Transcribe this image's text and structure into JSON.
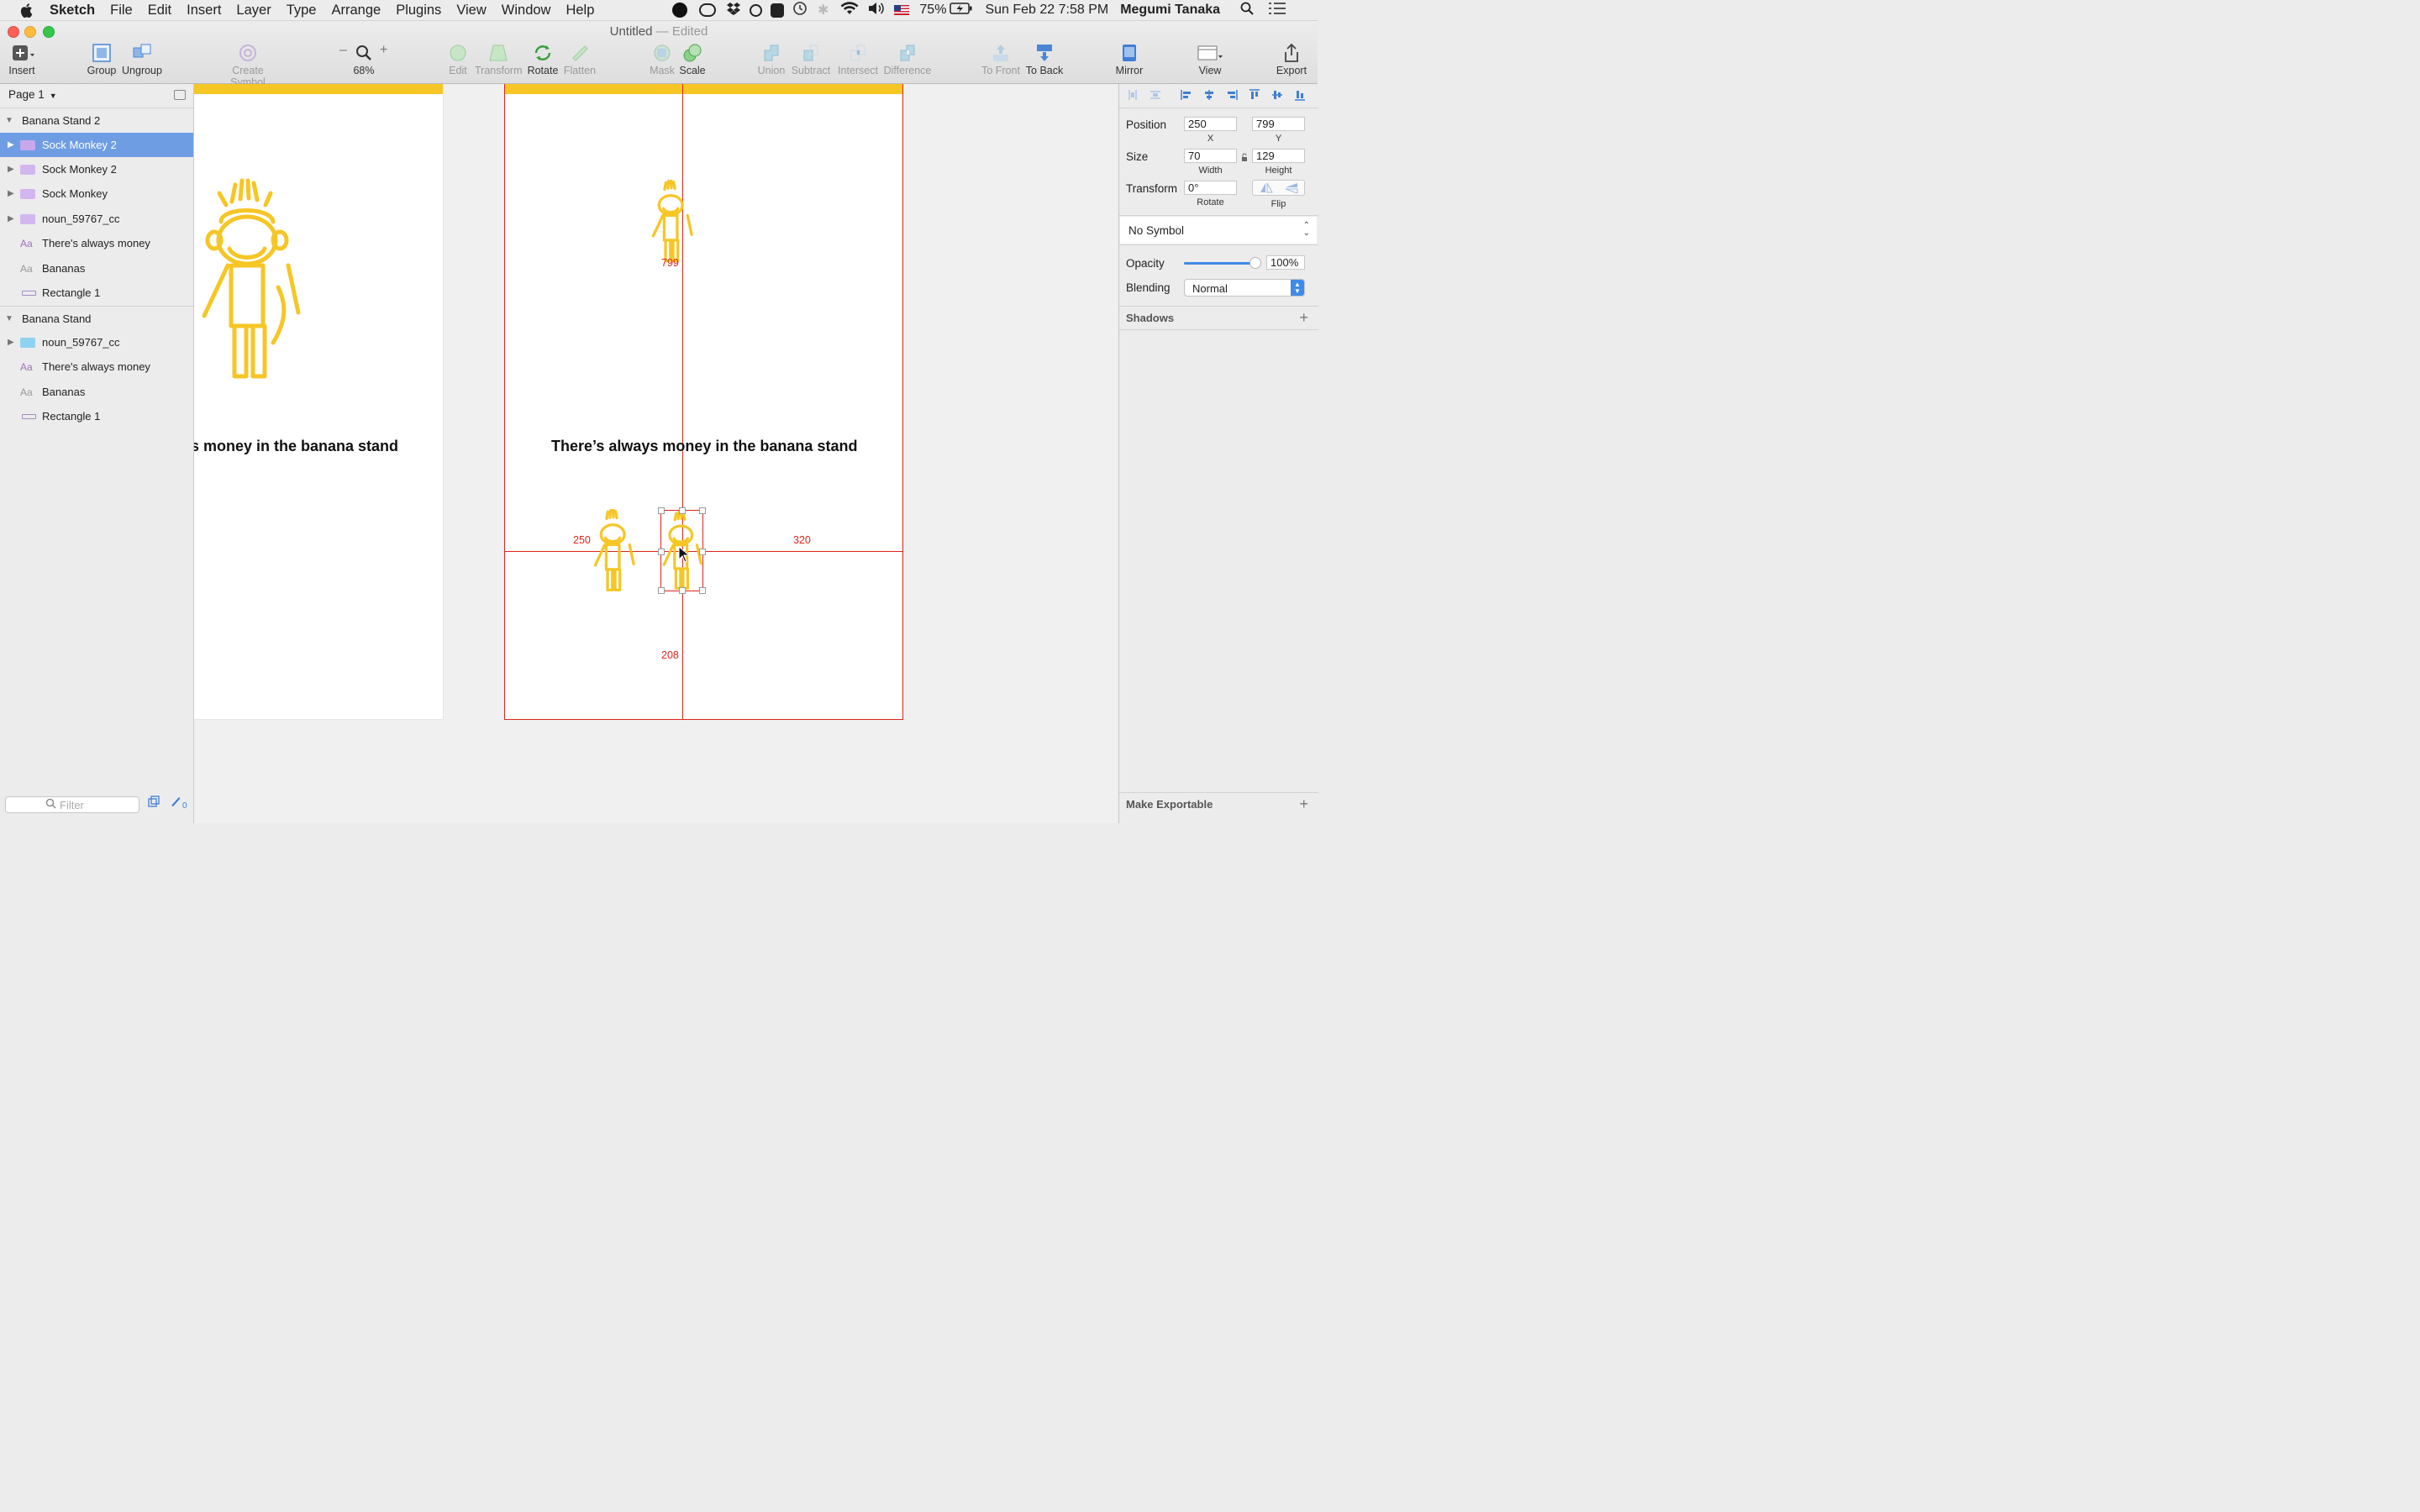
{
  "menubar": {
    "app_name": "Sketch",
    "items": [
      "File",
      "Edit",
      "Insert",
      "Layer",
      "Type",
      "Arrange",
      "Plugins",
      "View",
      "Window",
      "Help"
    ],
    "battery": "75%",
    "clock": "Sun Feb 22  7:58 PM",
    "user": "Megumi Tanaka"
  },
  "window": {
    "title": "Untitled",
    "status": "— Edited"
  },
  "toolbar": {
    "insert": "Insert",
    "group": "Group",
    "ungroup": "Ungroup",
    "create_symbol": "Create Symbol",
    "zoom": "68%",
    "edit": "Edit",
    "transform": "Transform",
    "rotate": "Rotate",
    "flatten": "Flatten",
    "mask": "Mask",
    "scale": "Scale",
    "union": "Union",
    "subtract": "Subtract",
    "intersect": "Intersect",
    "difference": "Difference",
    "to_front": "To Front",
    "to_back": "To Back",
    "mirror": "Mirror",
    "view": "View",
    "export": "Export"
  },
  "layers": {
    "page": "Page 1",
    "rows": [
      {
        "label": "Banana Stand 2",
        "kind": "group"
      },
      {
        "label": "Sock Monkey 2",
        "kind": "folder",
        "selected": true
      },
      {
        "label": "Sock Monkey 2",
        "kind": "folder"
      },
      {
        "label": "Sock Monkey",
        "kind": "folder"
      },
      {
        "label": "noun_59767_cc",
        "kind": "folder"
      },
      {
        "label": "There's always money",
        "kind": "text"
      },
      {
        "label": "Bananas",
        "kind": "text-plain"
      },
      {
        "label": "Rectangle 1",
        "kind": "rect"
      },
      {
        "label": "Banana Stand",
        "kind": "group"
      },
      {
        "label": "noun_59767_cc",
        "kind": "folder-blue"
      },
      {
        "label": "There's always money",
        "kind": "text"
      },
      {
        "label": "Bananas",
        "kind": "text-plain"
      },
      {
        "label": "Rectangle 1",
        "kind": "rect"
      }
    ],
    "filter_placeholder": "Filter",
    "badge_count": "0"
  },
  "canvas": {
    "left_headline": "s money in the banana stand",
    "headline": "There’s always money in the banana stand",
    "measure_top": "799",
    "measure_left": "250",
    "measure_right": "320",
    "measure_bottom": "208"
  },
  "inspector": {
    "position_label": "Position",
    "x": "250",
    "y": "799",
    "x_sub": "X",
    "y_sub": "Y",
    "size_label": "Size",
    "width": "70",
    "height": "129",
    "width_sub": "Width",
    "height_sub": "Height",
    "transform_label": "Transform",
    "rotate": "0°",
    "rotate_sub": "Rotate",
    "flip_sub": "Flip",
    "symbol": "No Symbol",
    "opacity_label": "Opacity",
    "opacity": "100%",
    "opacity_fraction": 1.0,
    "blending_label": "Blending",
    "blending": "Normal",
    "shadows": "Shadows",
    "make_exportable": "Make Exportable"
  },
  "colors": {
    "accent_yellow": "#f6c625",
    "selection_blue": "#6f9de3",
    "guide_red": "#e0241d"
  }
}
